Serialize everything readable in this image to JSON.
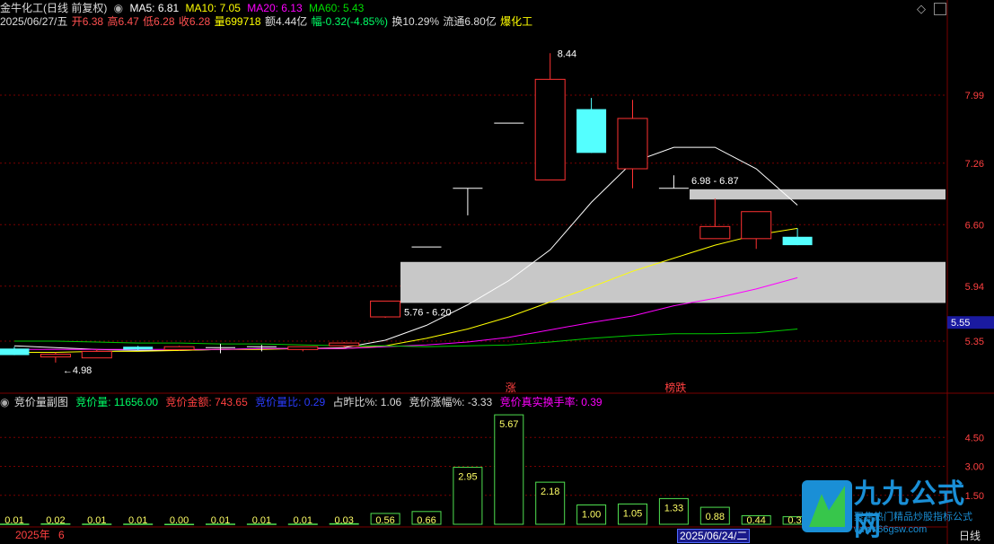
{
  "header": {
    "title": "金牛化工(日线 前复权)",
    "ma5": "MA5: 6.81",
    "ma10": "MA10: 7.05",
    "ma20": "MA20: 6.13",
    "ma60": "MA60: 5.43",
    "date": "2025/06/27/五",
    "open": "开6.38",
    "high": "高6.47",
    "low": "低6.28",
    "close": "收6.28",
    "volume": "量699718",
    "amount": "额4.44亿",
    "change": "幅-0.32(-4.85%)",
    "turnover": "换10.29%",
    "float": "流通6.80亿",
    "sector": "爆化工"
  },
  "subheader": {
    "name": "竞价量副图",
    "bid_vol": "竞价量: 11656.00",
    "bid_amt": "竞价金额: 743.65",
    "bid_ratio": "竞价量比: 0.29",
    "prev_ratio": "占昨比%: 1.06",
    "bid_change": "竞价涨幅%: -3.33",
    "bid_turnover": "竞价真实换手率: 0.39"
  },
  "footer": {
    "year": "2025年",
    "month": "6",
    "date_box": "2025/06/24/二",
    "period": "日线"
  },
  "watermark": {
    "brand": "九九公式网",
    "slogan": "聚焦热门精品炒股指标公式",
    "url": "www.66gsw.com"
  },
  "colors": {
    "up": "#ff3232",
    "down": "#54ffff",
    "flat": "#ffffff",
    "ma5": "#ffffff",
    "ma10": "#ffff00",
    "ma20": "#ff00ff",
    "ma60": "#00cc00",
    "zone": "#c8c8c8",
    "grid": "#7a0000",
    "axis_text": "#ff4040",
    "vol_bar": "#50e050",
    "vol_label": "#ffff66"
  },
  "chart_data": [
    {
      "type": "candlestick",
      "y_ticks": [
        7.99,
        7.26,
        6.6,
        5.94,
        5.35
      ],
      "current_price": "5.55",
      "candles": [
        {
          "o": 5.27,
          "c": 5.2,
          "h": 5.29,
          "l": 5.2
        },
        {
          "o": 5.18,
          "c": 5.21,
          "h": 5.23,
          "l": 5.12
        },
        {
          "o": 5.17,
          "c": 5.24,
          "h": 5.26,
          "l": 5.17
        },
        {
          "o": 5.29,
          "c": 5.26,
          "h": 5.3,
          "l": 5.25
        },
        {
          "o": 5.26,
          "c": 5.29,
          "h": 5.3,
          "l": 5.25
        },
        {
          "o": 5.28,
          "c": 5.28,
          "h": 5.32,
          "l": 5.22
        },
        {
          "o": 5.29,
          "c": 5.29,
          "h": 5.31,
          "l": 5.24
        },
        {
          "o": 5.26,
          "c": 5.29,
          "h": 5.29,
          "l": 5.24
        },
        {
          "o": 5.3,
          "c": 5.33,
          "h": 5.34,
          "l": 5.28
        },
        {
          "o": 5.61,
          "c": 5.78,
          "h": 5.78,
          "l": 5.6
        },
        {
          "o": 6.36,
          "c": 6.36,
          "h": 6.36,
          "l": 6.36
        },
        {
          "o": 6.99,
          "c": 6.99,
          "h": 6.99,
          "l": 6.7
        },
        {
          "o": 7.69,
          "c": 7.69,
          "h": 7.69,
          "l": 7.69
        },
        {
          "o": 7.08,
          "c": 8.16,
          "h": 8.44,
          "l": 7.08
        },
        {
          "o": 7.84,
          "c": 7.37,
          "h": 7.96,
          "l": 7.37
        },
        {
          "o": 7.2,
          "c": 7.74,
          "h": 7.94,
          "l": 6.99
        },
        {
          "o": 6.99,
          "c": 6.99,
          "h": 7.13,
          "l": 6.99
        },
        {
          "o": 6.45,
          "c": 6.58,
          "h": 6.88,
          "l": 6.45
        },
        {
          "o": 6.45,
          "c": 6.74,
          "h": 6.74,
          "l": 6.34
        },
        {
          "o": 6.47,
          "c": 6.38,
          "h": 6.56,
          "l": 6.38
        }
      ],
      "high_label": "8.44",
      "low_label": "4.98",
      "zones": [
        {
          "from": 5.76,
          "to": 6.2,
          "label": "5.76 - 6.20"
        },
        {
          "from": 6.87,
          "to": 6.98,
          "label": "6.98 - 6.87"
        }
      ],
      "markers": [
        {
          "idx": 12,
          "text": "涨"
        },
        {
          "idx": 16,
          "text": "榜跌"
        }
      ],
      "ma_series": [
        {
          "name": "MA5",
          "values": [
            5.3,
            5.28,
            5.26,
            5.25,
            5.25,
            5.26,
            5.27,
            5.27,
            5.28,
            5.36,
            5.52,
            5.74,
            6.0,
            6.33,
            6.84,
            7.27,
            7.43,
            7.43,
            7.2,
            6.81
          ]
        },
        {
          "name": "MA10",
          "values": [
            5.23,
            5.23,
            5.24,
            5.24,
            5.25,
            5.26,
            5.26,
            5.27,
            5.27,
            5.3,
            5.38,
            5.48,
            5.61,
            5.77,
            5.93,
            6.1,
            6.24,
            6.38,
            6.49,
            6.56
          ]
        },
        {
          "name": "MA20",
          "values": [
            5.26,
            5.26,
            5.26,
            5.26,
            5.26,
            5.26,
            5.27,
            5.27,
            5.27,
            5.29,
            5.31,
            5.34,
            5.39,
            5.47,
            5.55,
            5.62,
            5.73,
            5.81,
            5.91,
            6.03
          ]
        },
        {
          "name": "MA60",
          "values": [
            5.35,
            5.35,
            5.34,
            5.33,
            5.33,
            5.32,
            5.32,
            5.31,
            5.3,
            5.3,
            5.29,
            5.3,
            5.31,
            5.34,
            5.38,
            5.41,
            5.43,
            5.43,
            5.44,
            5.48
          ]
        }
      ]
    },
    {
      "type": "bar",
      "y_ticks": [
        4.5,
        3.0,
        1.5
      ],
      "values": [
        0.01,
        0.02,
        0.01,
        0.01,
        0.0,
        0.01,
        0.01,
        0.01,
        0.03,
        0.56,
        0.66,
        2.95,
        5.67,
        2.18,
        1.0,
        1.05,
        1.33,
        0.88,
        0.44,
        0.39
      ]
    }
  ]
}
